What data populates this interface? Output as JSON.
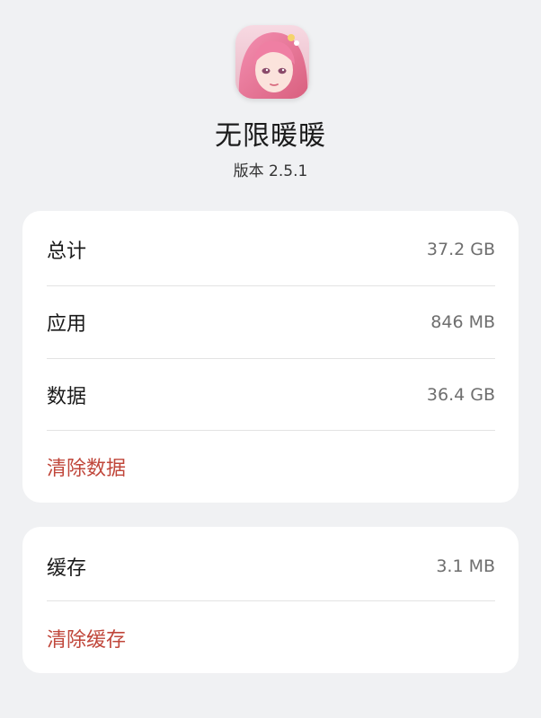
{
  "app": {
    "name": "无限暖暖",
    "version": "版本  2.5.1",
    "icon": "app-avatar-icon"
  },
  "storage": {
    "total_label": "总计",
    "total_value": "37.2 GB",
    "app_label": "应用",
    "app_value": "846 MB",
    "data_label": "数据",
    "data_value": "36.4 GB",
    "clear_data_label": "清除数据"
  },
  "cache": {
    "cache_label": "缓存",
    "cache_value": "3.1 MB",
    "clear_cache_label": "清除缓存"
  },
  "colors": {
    "background": "#f0f1f3",
    "card": "#ffffff",
    "action_red": "#c0463a"
  }
}
